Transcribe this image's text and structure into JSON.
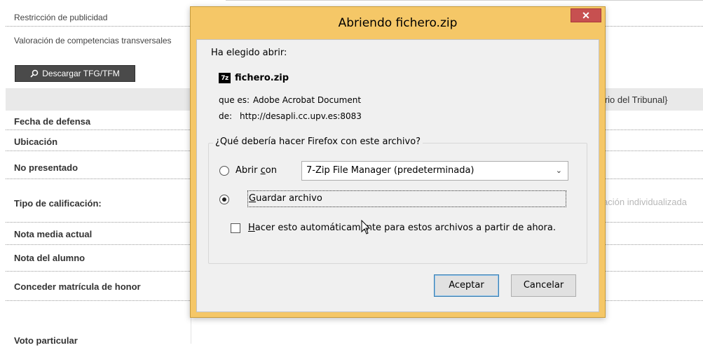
{
  "background": {
    "rows": [
      {
        "label": "Restricción de publicidad"
      },
      {
        "label": "Valoración de competencias transversales"
      }
    ],
    "download_button": "Descargar TFG/TFM",
    "table_header_right": "tario del Tribunal}",
    "fields": [
      {
        "label": "Fecha de defensa"
      },
      {
        "label": "Ubicación"
      },
      {
        "label": "No presentado"
      },
      {
        "label": "Tipo de calificación:",
        "right_text": "ación individualizada"
      },
      {
        "label": "Nota media actual"
      },
      {
        "label": "Nota del alumno"
      },
      {
        "label": "Conceder matrícula de honor"
      },
      {
        "label": "Voto particular"
      }
    ]
  },
  "dialog": {
    "title": "Abriendo fichero.zip",
    "close_glyph": "✕",
    "chosen_label": "Ha elegido abrir:",
    "file_icon_text": "7z",
    "file_name": "fichero.zip",
    "type_label": "que es:",
    "type_value": "Adobe Acrobat Document",
    "from_label": "de:",
    "from_value": "http://desapli.cc.upv.es:8083",
    "question": "¿Qué debería hacer Firefox con este archivo?",
    "open_with": {
      "pre": "Abrir ",
      "key": "c",
      "post": "on"
    },
    "app_selected": "7-Zip File Manager (predeterminada)",
    "save_file": {
      "pre": "",
      "key": "G",
      "post": "uardar archivo"
    },
    "auto_checkbox": {
      "pre": "",
      "key": "H",
      "post": "acer esto automáticamente para estos archivos a partir de ahora.",
      "checked": false
    },
    "selected_option": "save",
    "ok_button": "Aceptar",
    "cancel_button": "Cancelar"
  },
  "colors": {
    "dialog_frame": "#f5c767",
    "close_button": "#c75050",
    "download_button_bg": "#4a4a4a"
  }
}
